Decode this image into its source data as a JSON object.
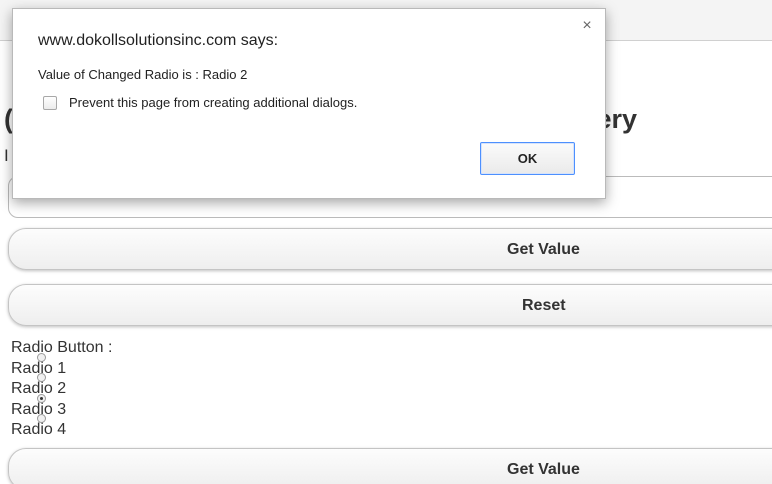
{
  "page": {
    "heading_visible": "uery",
    "subtext_visible": "I",
    "buttons": {
      "get_value_label": "Get Value",
      "reset_label": "Reset",
      "get_value_bottom_label": "Get Value"
    },
    "radio_group": {
      "label": "Radio Button :",
      "options": [
        {
          "label": "Radio 1",
          "checked": false
        },
        {
          "label": "Radio 2",
          "checked": true
        },
        {
          "label": "Radio 3",
          "checked": false
        },
        {
          "label": "Radio 4",
          "checked": false
        }
      ]
    }
  },
  "dialog": {
    "title": "www.dokollsolutionsinc.com says:",
    "message": "Value of Changed Radio is : Radio 2",
    "checkbox_label": "Prevent this page from creating additional dialogs.",
    "checkbox_checked": false,
    "ok_label": "OK",
    "close_glyph": "×"
  }
}
